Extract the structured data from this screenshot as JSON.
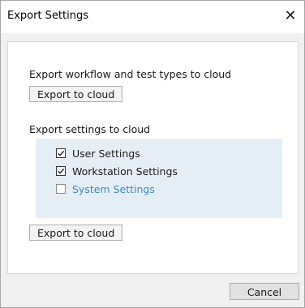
{
  "window": {
    "title": "Export Settings",
    "close_glyph": "✕"
  },
  "workflow_section": {
    "label": "Export workflow and test types to cloud",
    "button_label": "Export to cloud"
  },
  "settings_section": {
    "label": "Export settings to cloud",
    "options": [
      {
        "label": "User Settings",
        "checked": true,
        "enabled": true
      },
      {
        "label": "Workstation Settings",
        "checked": true,
        "enabled": true
      },
      {
        "label": "System Settings",
        "checked": false,
        "enabled": false
      }
    ],
    "button_label": "Export to cloud"
  },
  "footer": {
    "cancel_label": "Cancel"
  },
  "colors": {
    "disabled_text": "#3a8cc6",
    "options_background": "#e6eef5"
  }
}
